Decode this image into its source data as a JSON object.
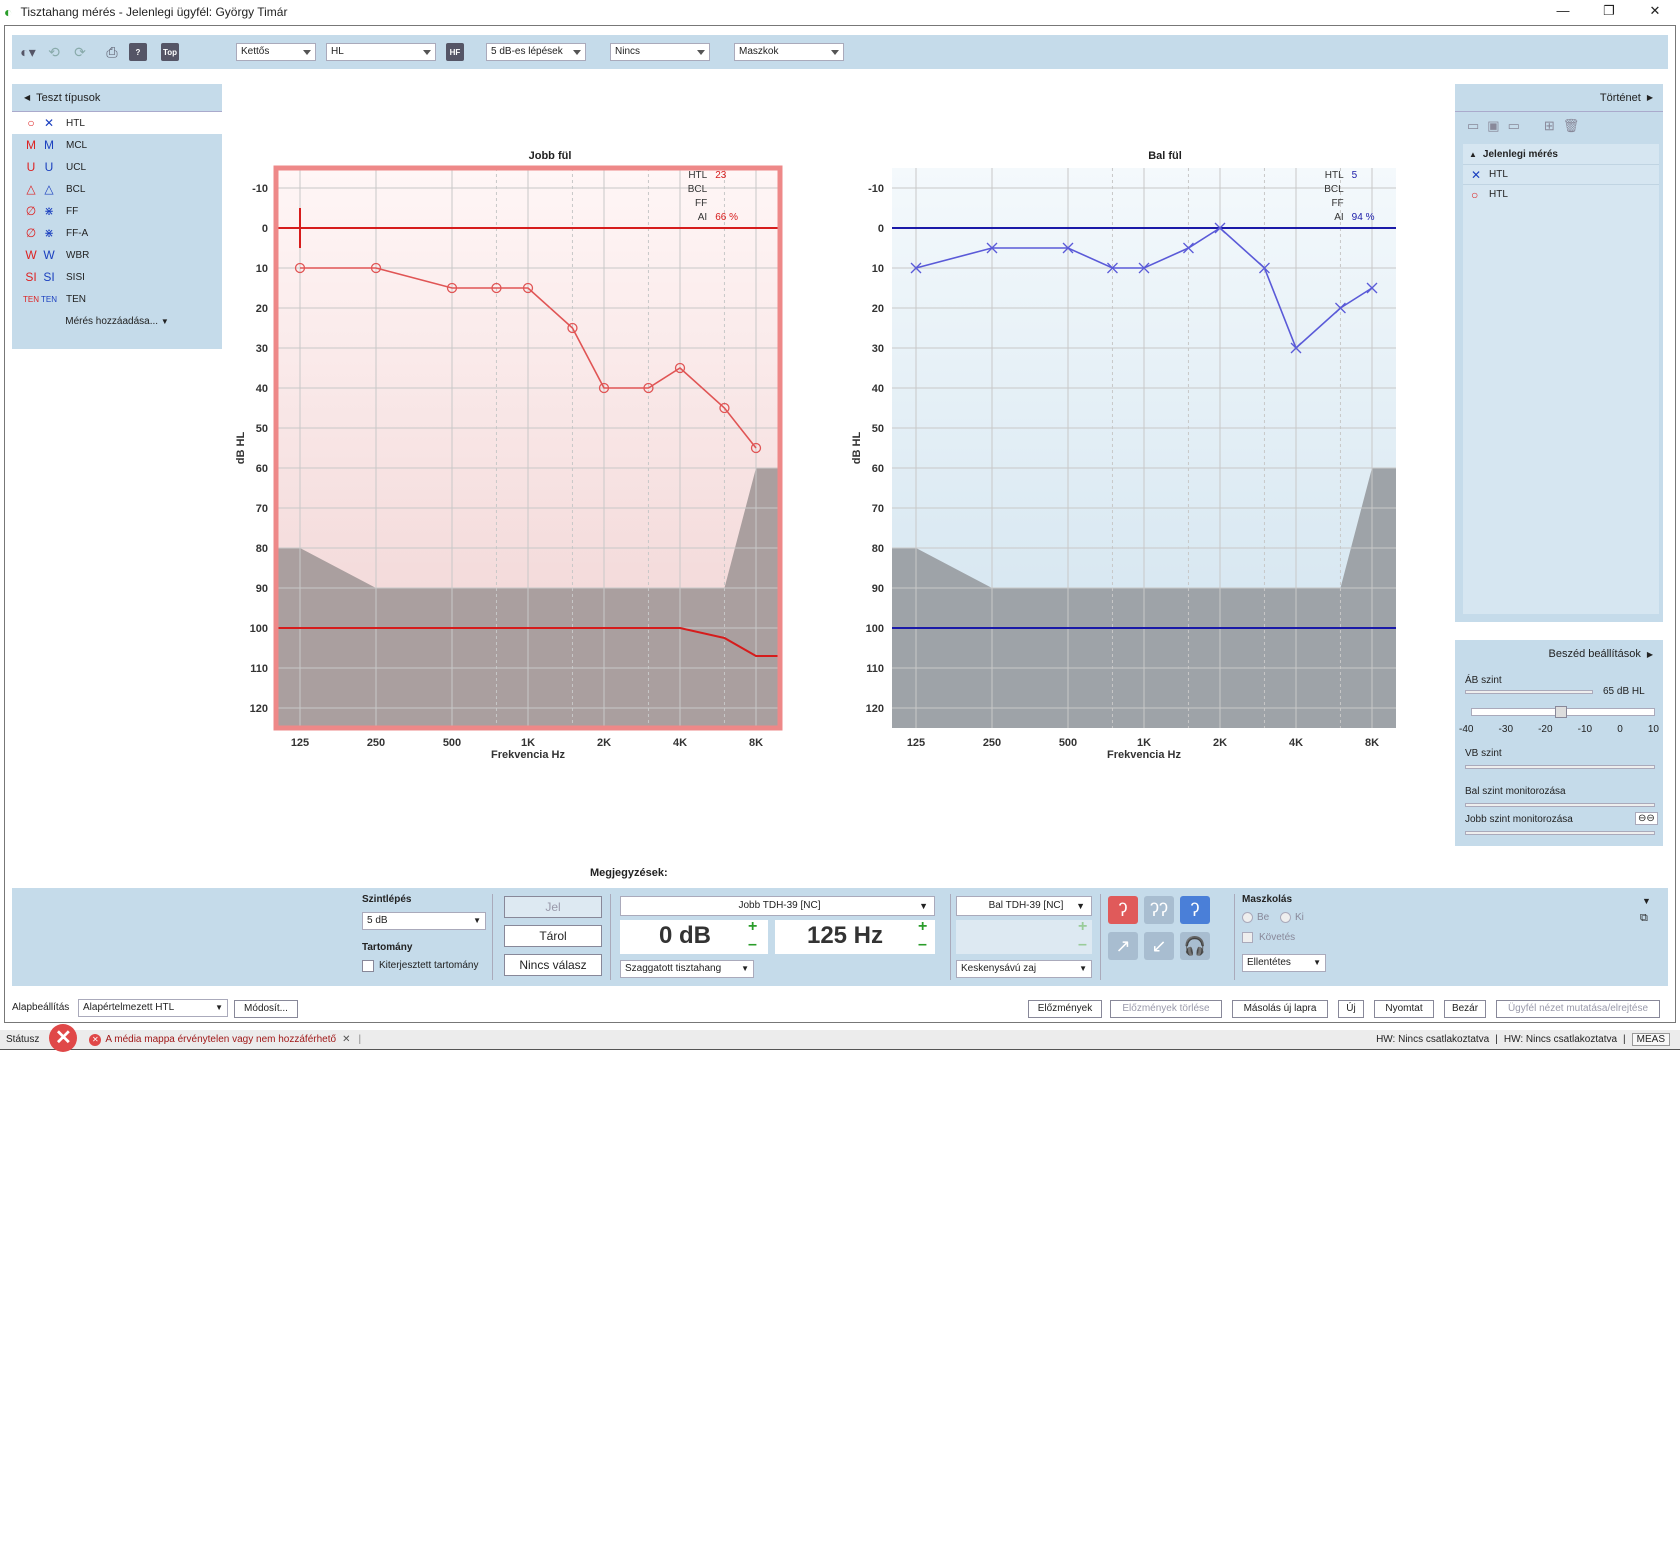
{
  "window": {
    "title": "Tisztahang mérés - Jelenlegi ügyfél: György Timár"
  },
  "toolbar": {
    "dd_mode": "Kettős",
    "dd_unit": "HL",
    "hf": "HF",
    "top": "Top",
    "dd_step": "5 dB-es lépések",
    "dd_none": "Nincs",
    "dd_mask": "Maszkok"
  },
  "left_panel": {
    "title": "Teszt típusok",
    "items": [
      {
        "s1": "○",
        "s2": "✕",
        "label": "HTL"
      },
      {
        "s1": "M",
        "s2": "M",
        "label": "MCL"
      },
      {
        "s1": "U",
        "s2": "U",
        "label": "UCL"
      },
      {
        "s1": "△",
        "s2": "△",
        "label": "BCL"
      },
      {
        "s1": "∅",
        "s2": "⋇",
        "label": "FF"
      },
      {
        "s1": "∅",
        "s2": "⋇",
        "label": "FF-A"
      },
      {
        "s1": "W",
        "s2": "W",
        "label": "WBR"
      },
      {
        "s1": "SI",
        "s2": "SI",
        "label": "SISI"
      },
      {
        "s1": "TEN",
        "s2": "TEN",
        "label": "TEN"
      }
    ],
    "add": "Mérés hozzáadása..."
  },
  "chart_data": [
    {
      "type": "line",
      "title": "Jobb fül",
      "xlabel": "Frekvencia Hz",
      "ylabel": "dB HL",
      "x_ticks": [
        "125",
        "250",
        "500",
        "1K",
        "2K",
        "4K",
        "8K"
      ],
      "y_ticks": [
        "-10",
        "0",
        "10",
        "20",
        "30",
        "40",
        "50",
        "60",
        "70",
        "80",
        "90",
        "100",
        "110",
        "120"
      ],
      "ylim": [
        -15,
        125
      ],
      "color": "#e05555",
      "series": [
        {
          "name": "HTL",
          "x": [
            125,
            250,
            500,
            750,
            1000,
            1500,
            2000,
            3000,
            4000,
            6000,
            8000
          ],
          "y": [
            10,
            10,
            15,
            15,
            15,
            25,
            40,
            40,
            35,
            45,
            55
          ]
        }
      ],
      "ref_line": {
        "y0": 0,
        "level": 100
      },
      "readout": {
        "HTL": "23",
        "BCL": "",
        "FF": "",
        "AI": "66 %"
      }
    },
    {
      "type": "line",
      "title": "Bal fül",
      "xlabel": "Frekvencia Hz",
      "ylabel": "dB HL",
      "x_ticks": [
        "125",
        "250",
        "500",
        "1K",
        "2K",
        "4K",
        "8K"
      ],
      "y_ticks": [
        "-10",
        "0",
        "10",
        "20",
        "30",
        "40",
        "50",
        "60",
        "70",
        "80",
        "90",
        "100",
        "110",
        "120"
      ],
      "ylim": [
        -15,
        125
      ],
      "color": "#5a5ad8",
      "series": [
        {
          "name": "HTL",
          "x": [
            125,
            250,
            500,
            750,
            1000,
            1500,
            2000,
            3000,
            4000,
            6000,
            8000
          ],
          "y": [
            10,
            5,
            5,
            10,
            10,
            5,
            0,
            10,
            30,
            20,
            15
          ]
        }
      ],
      "ref_line": {
        "y0": 0,
        "level": 100
      },
      "readout": {
        "HTL": "5",
        "BCL": "",
        "FF": "",
        "AI": "94 %"
      }
    }
  ],
  "history": {
    "title": "Történet",
    "group": "Jelenlegi mérés",
    "items": [
      {
        "icon": "✕",
        "label": "HTL"
      },
      {
        "icon": "○",
        "label": "HTL"
      }
    ]
  },
  "speech": {
    "title": "Beszéd beállítások",
    "ab": "ÁB szint",
    "ab_value": "65 dB HL",
    "scale": [
      "-40",
      "-30",
      "-20",
      "-10",
      "0",
      "10"
    ],
    "vb": "VB szint",
    "bal": "Bal szint monitorozása",
    "jobb": "Jobb szint monitorozása"
  },
  "notes_label": "Megjegyzések:",
  "bottom": {
    "step_label": "Szintlépés",
    "step_value": "5 dB",
    "range_label": "Tartomány",
    "range_cb": "Kiterjesztett tartomány",
    "jel": "Jel",
    "tarol": "Tárol",
    "nincs": "Nincs válasz",
    "right_tr": "Jobb TDH-39 [NC]",
    "db": "0 dB",
    "hz": "125 Hz",
    "stim": "Szaggatott tisztahang",
    "left_tr": "Bal TDH-39 [NC]",
    "noise": "Keskenysávú zaj",
    "mask_label": "Maszkolás",
    "be": "Be",
    "ki": "Ki",
    "kovetes": "Követés",
    "ellentetes": "Ellentétes"
  },
  "footer": {
    "alap_label": "Alapbeállítás",
    "alap_value": "Alapértelmezett HTL",
    "modosit": "Módosít...",
    "buttons": [
      "Előzmények",
      "Előzmények törlése",
      "Másolás új lapra",
      "Új",
      "Nyomtat",
      "Bezár",
      "Ügyfél nézet mutatása/elrejtése"
    ]
  },
  "status": {
    "label": "Státusz",
    "msg": "A média mappa érvénytelen vagy nem hozzáférhető",
    "hw1": "HW:  Nincs csatlakoztatva",
    "hw2": "HW:  Nincs csatlakoztatva",
    "meas": "MEAS"
  },
  "colors": {
    "panel": "#c5dbea",
    "right_ear": "#e05555",
    "left_ear": "#5a5ad8"
  }
}
